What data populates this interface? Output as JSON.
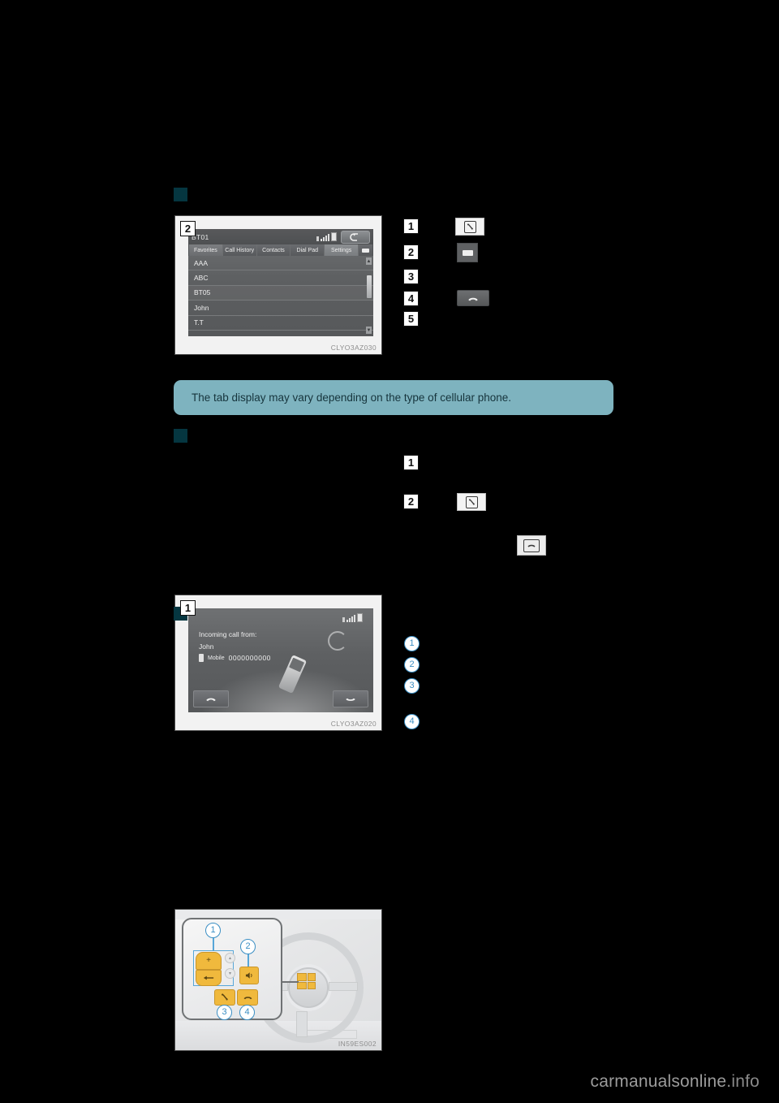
{
  "page": {
    "footer_brand": "carmanualsonline",
    "footer_tld": ".info"
  },
  "notice": {
    "text": "The tab display may vary depending on the type of cellular phone."
  },
  "section_phone_screen": {
    "marker": "section-marker",
    "figure_code": "CLYO3AZ030",
    "figure_number": "2",
    "screen": {
      "header_title": "BT01",
      "status": {
        "bluetooth": "bluetooth-icon",
        "signal": "signal-bars-icon",
        "battery": "battery-icon"
      },
      "back_button": "back-arrow-icon",
      "tabs": [
        {
          "label": "Favorites",
          "state": "active"
        },
        {
          "label": "Call History",
          "state": "normal"
        },
        {
          "label": "Contacts",
          "state": "normal"
        },
        {
          "label": "Dial Pad",
          "state": "normal"
        },
        {
          "label": "Settings",
          "state": "selected"
        }
      ],
      "tab_extra_button": "minimize-icon",
      "contacts": [
        "AAA",
        "ABC",
        "BT05",
        "John",
        "T.T"
      ],
      "scroll_up": "▲",
      "scroll_down": "▼"
    },
    "callouts": [
      {
        "number": "1",
        "icon": "off-hook-handset-icon",
        "icon_style": "light"
      },
      {
        "number": "2",
        "icon": "minimize-bar-icon",
        "icon_style": "dark"
      },
      {
        "number": "3",
        "icon": "",
        "icon_style": "none"
      },
      {
        "number": "4",
        "icon": "on-hook-handset-icon",
        "icon_style": "darkgrad"
      },
      {
        "number": "5",
        "icon": "",
        "icon_style": "none"
      }
    ]
  },
  "section_incoming_call": {
    "marker": "section-marker",
    "figure_code": "CLYO3AZ020",
    "figure_number": "1",
    "screen": {
      "status": {
        "bluetooth": "bluetooth-icon",
        "signal": "signal-bars-icon",
        "battery": "battery-icon"
      },
      "line1": "Incoming call from:",
      "line2": "John",
      "line3_label": "Mobile",
      "line3_number": "0000000000",
      "answer_button": "answer-call-icon",
      "decline_button": "end-call-icon"
    },
    "callouts": [
      {
        "number": "1",
        "icon": "",
        "icon_style": "none"
      },
      {
        "number": "2",
        "icon": "off-hook-handset-icon",
        "icon_style": "light"
      }
    ],
    "extra_icon": {
      "icon": "on-hook-handset-icon",
      "icon_style": "light"
    }
  },
  "section_steering_controls": {
    "marker": "section-marker",
    "figure_code": "IN59ES002",
    "buttons": [
      {
        "label": "+",
        "name": "volume-up-button"
      },
      {
        "label": "←",
        "name": "back-button"
      },
      {
        "label": "▴",
        "name": "up-button"
      },
      {
        "label": "▾",
        "name": "down-button"
      },
      {
        "label": "",
        "name": "talk-button"
      },
      {
        "label": "",
        "name": "off-hook-button"
      },
      {
        "label": "",
        "name": "on-hook-button"
      }
    ],
    "callouts": [
      {
        "number": "1"
      },
      {
        "number": "2"
      },
      {
        "number": "3"
      },
      {
        "number": "4"
      }
    ]
  }
}
